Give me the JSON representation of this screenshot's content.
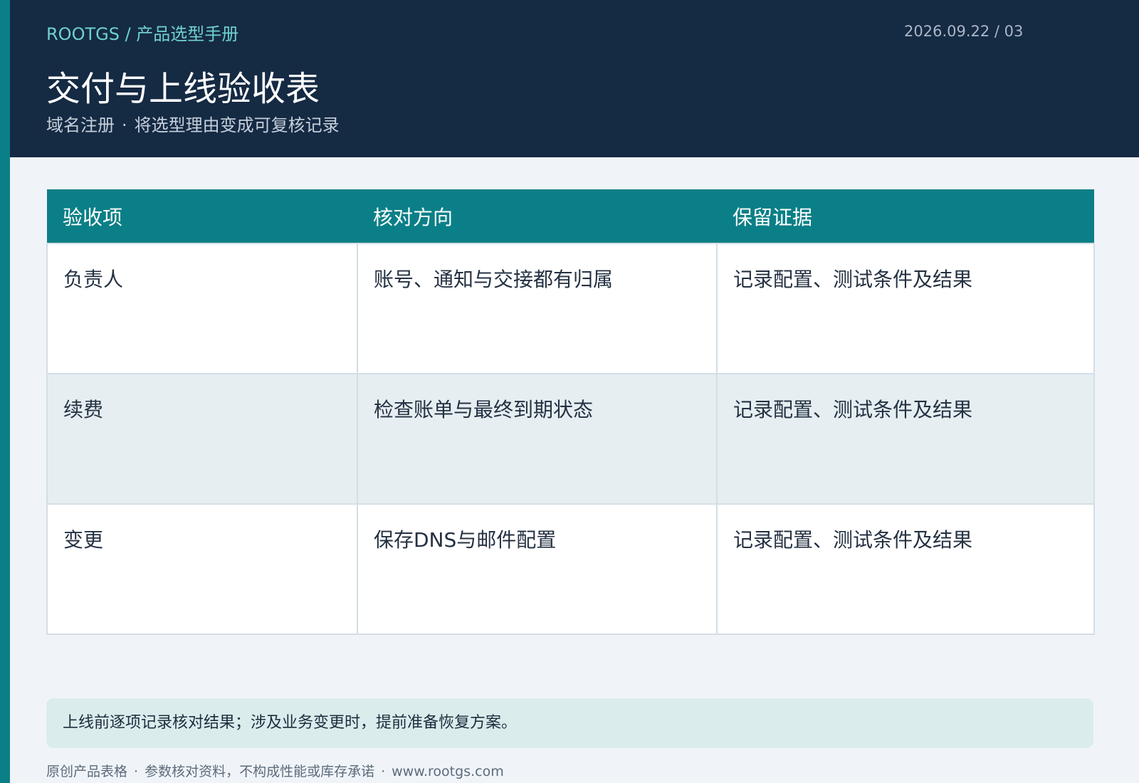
{
  "header": {
    "breadcrumb": "ROOTGS / 产品选型手册",
    "datecode": "2026.09.22 / 03",
    "title": "交付与上线验收表",
    "subtitle_left": "域名注册",
    "subtitle_separator": "·",
    "subtitle_right": "将选型理由变成可复核记录"
  },
  "table": {
    "columns": [
      "验收项",
      "核对方向",
      "保留证据"
    ],
    "rows": [
      [
        "负责人",
        "账号、通知与交接都有归属",
        "记录配置、测试条件及结果"
      ],
      [
        "续费",
        "检查账单与最终到期状态",
        "记录配置、测试条件及结果"
      ],
      [
        "变更",
        "保存DNS与邮件配置",
        "记录配置、测试条件及结果"
      ]
    ]
  },
  "note": "上线前逐项记录核对结果；涉及业务变更时，提前准备恢复方案。",
  "footer": {
    "items": [
      "原创产品表格",
      "参数核对资料，不构成性能或库存承诺",
      "www.rootgs.com"
    ],
    "separator": "·"
  },
  "colors": {
    "header_bg": "#152a43",
    "accent": "#0b7f87",
    "breadcrumb": "#6fd1cf",
    "page_bg": "#f0f4f8",
    "note_bg": "#daecec"
  }
}
